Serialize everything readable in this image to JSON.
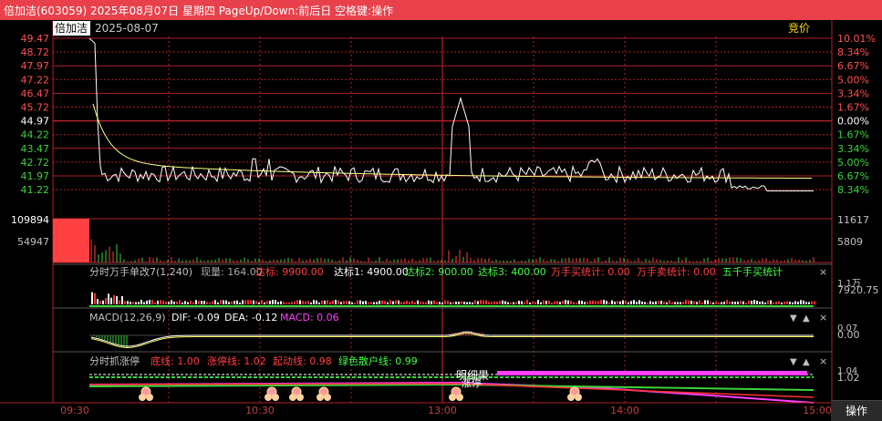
{
  "header": {
    "title": "倍加洁(603059)  2025年08月07日  星期四  PageUp/Down:前后日  空格键:操作"
  },
  "price_panel": {
    "stock_name": "倍加洁",
    "date": "2025-08-07",
    "auction_label": "竞价",
    "left_ticks": [
      "49.47",
      "48.72",
      "47.97",
      "47.22",
      "46.47",
      "45.72",
      "44.97",
      "44.22",
      "43.47",
      "42.72",
      "41.97",
      "41.22"
    ],
    "right_ticks": [
      "10.01%",
      "8.34%",
      "6.67%",
      "5.00%",
      "3.34%",
      "1.67%",
      "0.00%",
      "1.67%",
      "3.34%",
      "5.00%",
      "6.67%",
      "8.34%"
    ],
    "prev_close": "44.97",
    "colors": {
      "up": "#ff5050",
      "down": "#3cd23c",
      "flat": "#ffffff",
      "avg": "#ffff80",
      "grid": "#b0202a"
    }
  },
  "volume_panel": {
    "left_ticks": [
      "109894",
      "54947"
    ],
    "right_ticks": [
      "11617",
      "5809"
    ]
  },
  "wan_panel": {
    "title": "分时万手单改7(1,240)",
    "items": [
      {
        "label": "现量: 164.00",
        "color": "#aaaaaa"
      },
      {
        "label": "达标: 9900.00",
        "color": "#ff4040"
      },
      {
        "label": "达标1: 4900.00",
        "color": "#ffffff"
      },
      {
        "label": "达标2: 900.00",
        "color": "#40ff40"
      },
      {
        "label": "达标3: 400.00",
        "color": "#40ff40"
      },
      {
        "label": "万手买统计: 0.00",
        "color": "#ff4040"
      },
      {
        "label": "万手卖统计: 0.00",
        "color": "#ff4040"
      },
      {
        "label": "五千手买统计",
        "color": "#40ff40"
      }
    ],
    "right_ticks": [
      "1.1万",
      "7920.75"
    ]
  },
  "macd_panel": {
    "title": "MACD(12,26,9)",
    "dif": "DIF: -0.09",
    "dea": "DEA: -0.12",
    "macd": "MACD: 0.06",
    "right_ticks": [
      "0.07",
      "0.00"
    ]
  },
  "zt_panel": {
    "title": "分时抓涨停",
    "items": [
      {
        "label": "底线: 1.00",
        "color": "#ff4040"
      },
      {
        "label": "涨停线: 1.02",
        "color": "#ff4040"
      },
      {
        "label": "起动线: 0.98",
        "color": "#ff4040"
      },
      {
        "label": "绿色散户线: 0.99",
        "color": "#40ff40"
      }
    ],
    "overlay_text_1": "明细果",
    "overlay_text_2": "涨停",
    "right_ticks": [
      "1.04",
      "1.02"
    ]
  },
  "time_axis": {
    "labels": [
      "09:30",
      "10:30",
      "13:00",
      "14:00",
      "15:00"
    ]
  },
  "status": {
    "operate": "操作"
  }
}
